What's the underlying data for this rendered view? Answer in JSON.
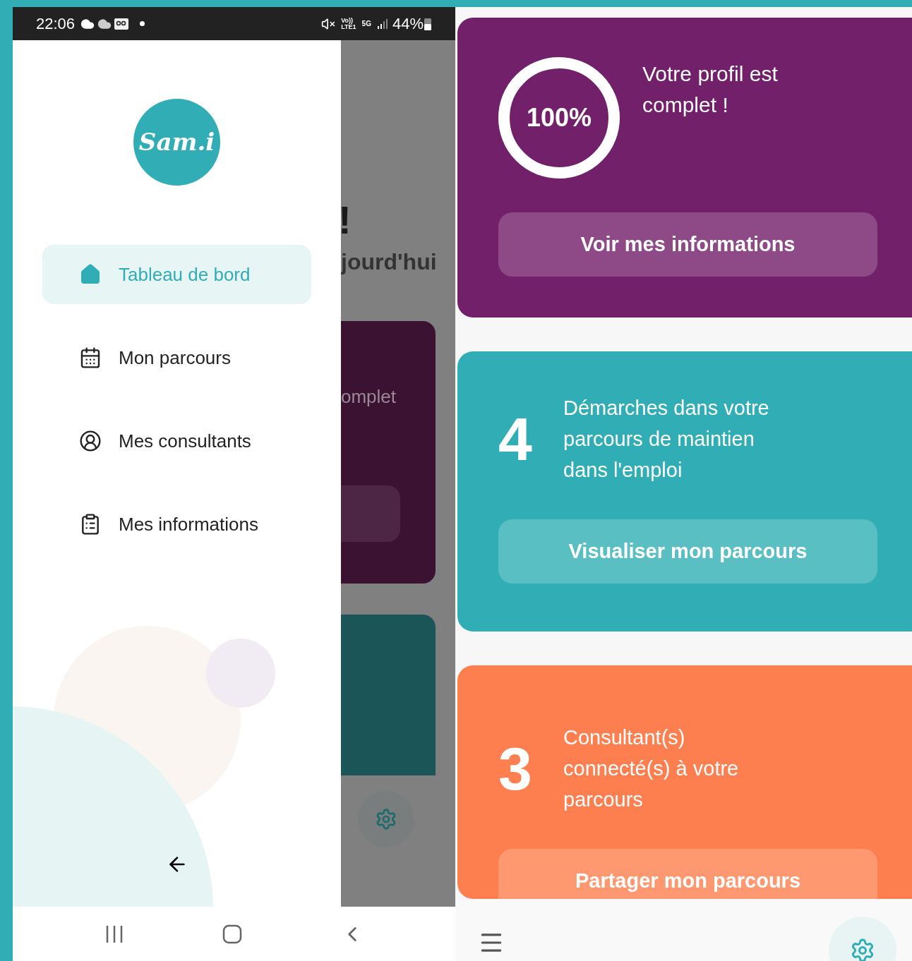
{
  "status_bar": {
    "time": "22:06",
    "network": [
      "Vo))",
      "LTE1",
      "5G"
    ],
    "battery": "44%"
  },
  "drawer": {
    "logo": "Sam.i",
    "items": [
      {
        "label": "Tableau de bord",
        "selected": true
      },
      {
        "label": "Mon parcours",
        "selected": false
      },
      {
        "label": "Mes consultants",
        "selected": false
      },
      {
        "label": "Mes informations",
        "selected": false
      }
    ]
  },
  "background_screen": {
    "texts": [
      "!",
      "jourd'hui",
      "omplet"
    ]
  },
  "cards": [
    {
      "kind": "progress",
      "level": 1,
      "value": "100%",
      "text": "Votre profil est complet !",
      "button": "Voir mes informations",
      "color": "#73206b"
    },
    {
      "kind": "count",
      "value": "4",
      "text": "Démarches dans votre parcours de maintien dans l'emploi",
      "button": "Visualiser mon parcours",
      "color": "#31adb5"
    },
    {
      "kind": "count",
      "value": "3",
      "text": "Consultant(s) connecté(s) à votre parcours",
      "button": "Partager mon parcours",
      "color": "#fd7f50"
    }
  ]
}
